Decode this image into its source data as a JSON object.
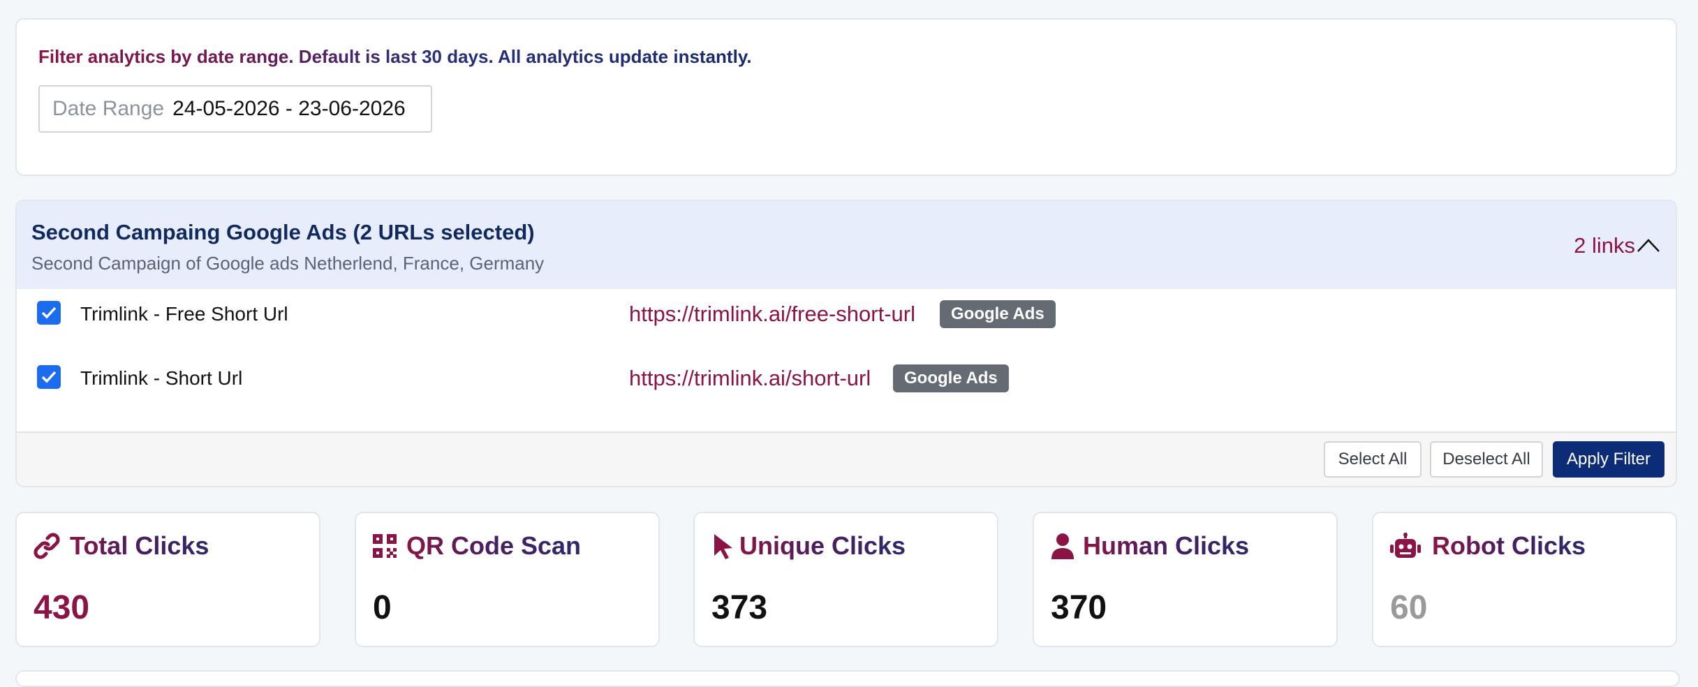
{
  "filter": {
    "note": "Filter analytics by date range. Default is last 30 days. All analytics update instantly.",
    "date_label": "Date Range",
    "date_value": "24-05-2026 - 23-06-2026"
  },
  "campaign": {
    "title": "Second Campaing Google Ads (2 URLs selected)",
    "description": "Second Campaign of Google ads Netherlend, France, Germany",
    "links_count": "2 links",
    "urls": [
      {
        "name": "Trimlink - Free Short Url",
        "url": "https://trimlink.ai/free-short-url",
        "tag": "Google Ads",
        "checked": true
      },
      {
        "name": "Trimlink - Short Url",
        "url": "https://trimlink.ai/short-url",
        "tag": "Google Ads",
        "checked": true
      }
    ],
    "buttons": {
      "select_all": "Select All",
      "deselect_all": "Deselect All",
      "apply_filter": "Apply Filter"
    }
  },
  "stats": [
    {
      "title": "Total Clicks",
      "value": "430",
      "icon": "link-icon",
      "value_color": "#8a1445"
    },
    {
      "title": "QR Code Scan",
      "value": "0",
      "icon": "qrcode-icon",
      "value_color": "#111111"
    },
    {
      "title": "Unique Clicks",
      "value": "373",
      "icon": "pointer-icon",
      "value_color": "#111111"
    },
    {
      "title": "Human Clicks",
      "value": "370",
      "icon": "user-icon",
      "value_color": "#111111"
    },
    {
      "title": "Robot Clicks",
      "value": "60",
      "icon": "robot-icon",
      "value_color": "#9a9a9a"
    }
  ],
  "colors": {
    "accent": "#8a1445",
    "primary": "#0d2c78",
    "checkbox": "#1c6cf2",
    "badge": "#656b73"
  }
}
